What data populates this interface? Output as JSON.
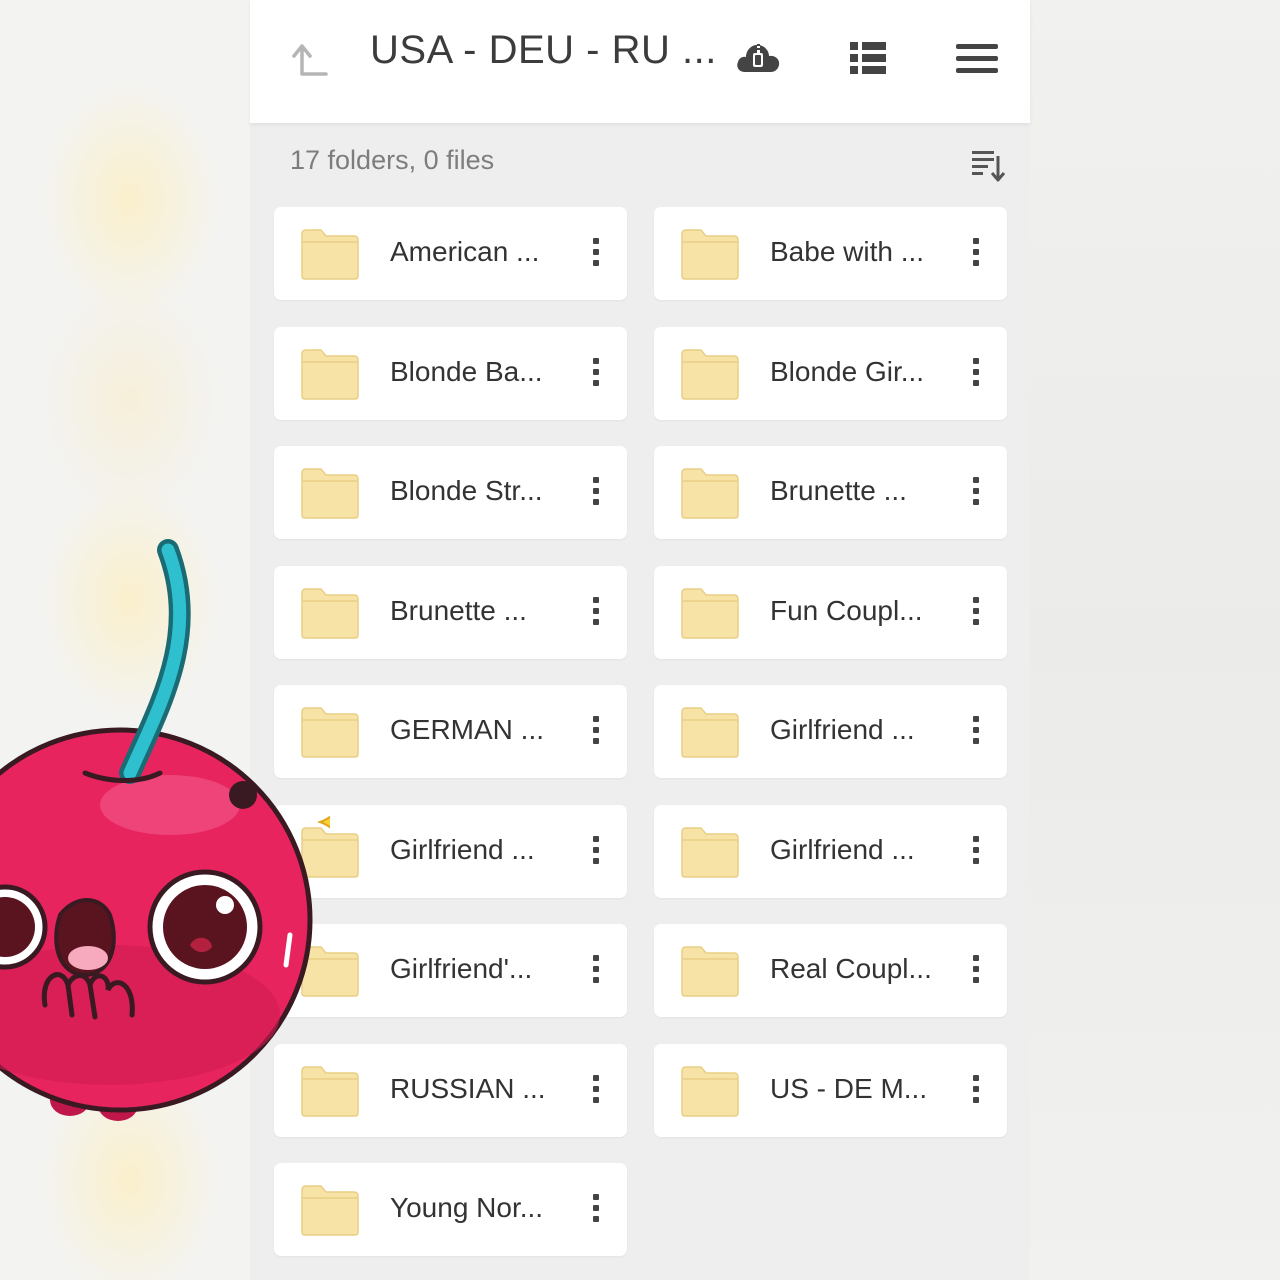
{
  "header": {
    "title": "USA - DEU - RU ..."
  },
  "summary": "17 folders, 0 files",
  "icons": {
    "up": "arrow-up-left-icon",
    "cloud": "cloud-zip-icon",
    "list": "list-view-icon",
    "menu": "hamburger-menu-icon",
    "sort": "sort-icon",
    "more": "more-vertical-icon",
    "folder": "folder-icon"
  },
  "colors": {
    "folder": "#f8e3a6",
    "cherry": "#e8245f",
    "stem": "#27b4c2"
  },
  "folders": [
    {
      "label": "American ..."
    },
    {
      "label": "Babe with ..."
    },
    {
      "label": "Blonde Ba..."
    },
    {
      "label": "Blonde Gir..."
    },
    {
      "label": "Blonde Str..."
    },
    {
      "label": "Brunette ..."
    },
    {
      "label": "Brunette ..."
    },
    {
      "label": "Fun Coupl..."
    },
    {
      "label": "GERMAN ..."
    },
    {
      "label": "Girlfriend ..."
    },
    {
      "label": "Girlfriend ..."
    },
    {
      "label": "Girlfriend ..."
    },
    {
      "label": "Girlfriend'..."
    },
    {
      "label": "Real Coupl..."
    },
    {
      "label": "RUSSIAN ..."
    },
    {
      "label": "US - DE M..."
    },
    {
      "label": "Young Nor..."
    }
  ]
}
